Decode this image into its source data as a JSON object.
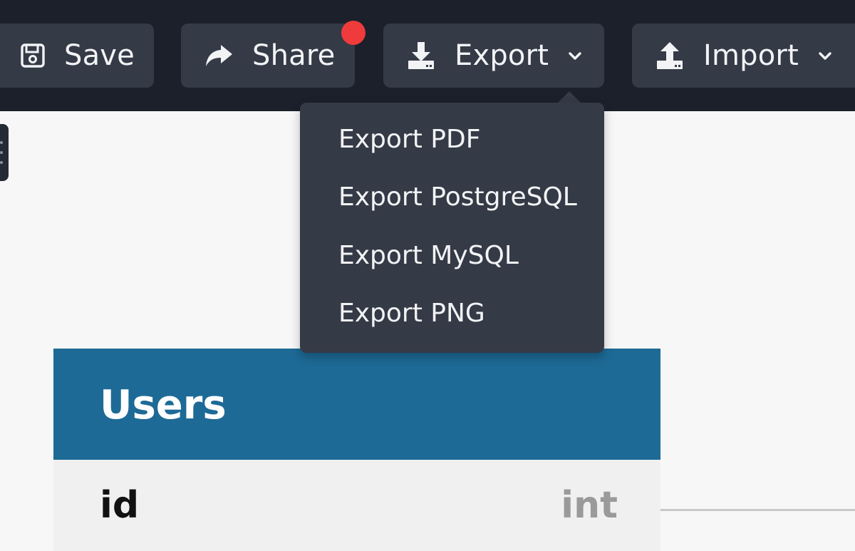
{
  "toolbar": {
    "save": {
      "label": "Save",
      "icon": "floppy-disk-icon"
    },
    "share": {
      "label": "Share",
      "icon": "share-arrow-icon",
      "has_notification": true
    },
    "export": {
      "label": "Export",
      "icon": "download-tray-icon"
    },
    "import": {
      "label": "Import",
      "icon": "upload-tray-icon"
    }
  },
  "export_menu": {
    "items": [
      {
        "label": "Export PDF"
      },
      {
        "label": "Export PostgreSQL"
      },
      {
        "label": "Export MySQL"
      },
      {
        "label": "Export PNG"
      }
    ]
  },
  "table": {
    "name": "Users",
    "fields": [
      {
        "name": "id",
        "type": "int"
      }
    ]
  },
  "colors": {
    "topbar_bg": "#1b202b",
    "button_bg": "#343a46",
    "notification": "#ef3b3b",
    "table_header": "#1d6a96"
  }
}
